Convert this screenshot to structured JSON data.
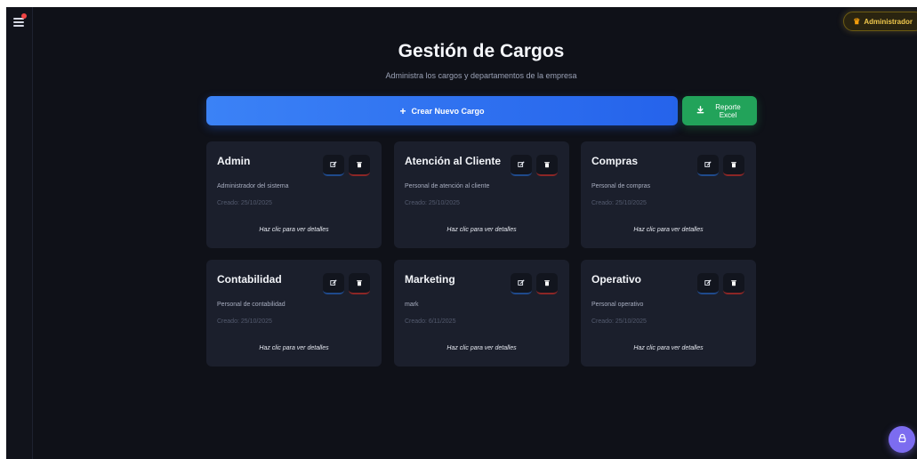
{
  "header": {
    "title": "Gestión de Cargos",
    "subtitle": "Administra los cargos y departamentos de la empresa",
    "user_badge": "Administrador"
  },
  "actions": {
    "create_label": "Crear Nuevo Cargo",
    "create_icon": "plus-icon",
    "excel_label": "Reporte Excel",
    "excel_icon": "download-icon"
  },
  "cards": [
    {
      "name": "Admin",
      "description": "Administrador del sistema",
      "created": "Creado: 25/10/2025",
      "hint": "Haz clic para ver detalles"
    },
    {
      "name": "Atención al Cliente",
      "description": "Personal de atención al cliente",
      "created": "Creado: 25/10/2025",
      "hint": "Haz clic para ver detalles"
    },
    {
      "name": "Compras",
      "description": "Personal de compras",
      "created": "Creado: 25/10/2025",
      "hint": "Haz clic para ver detalles"
    },
    {
      "name": "Contabilidad",
      "description": "Personal de contabilidad",
      "created": "Creado: 25/10/2025",
      "hint": "Haz clic para ver detalles"
    },
    {
      "name": "Marketing",
      "description": "mark",
      "created": "Creado: 6/11/2025",
      "hint": "Haz clic para ver detalles"
    },
    {
      "name": "Operativo",
      "description": "Personal operativo",
      "created": "Creado: 25/10/2025",
      "hint": "Haz clic para ver detalles"
    }
  ],
  "colors": {
    "background": "#0f1118",
    "card": "#1b1f2c",
    "primary": "#3b82f6",
    "success": "#22a35a",
    "danger": "#ef4444",
    "badge": "#f2c94c",
    "fab": "#7c6cf0"
  },
  "icons": {
    "menu": "menu-icon",
    "user_badge": "crown-icon",
    "edit": "edit-icon",
    "delete": "trash-icon",
    "fab": "lock-icon"
  }
}
